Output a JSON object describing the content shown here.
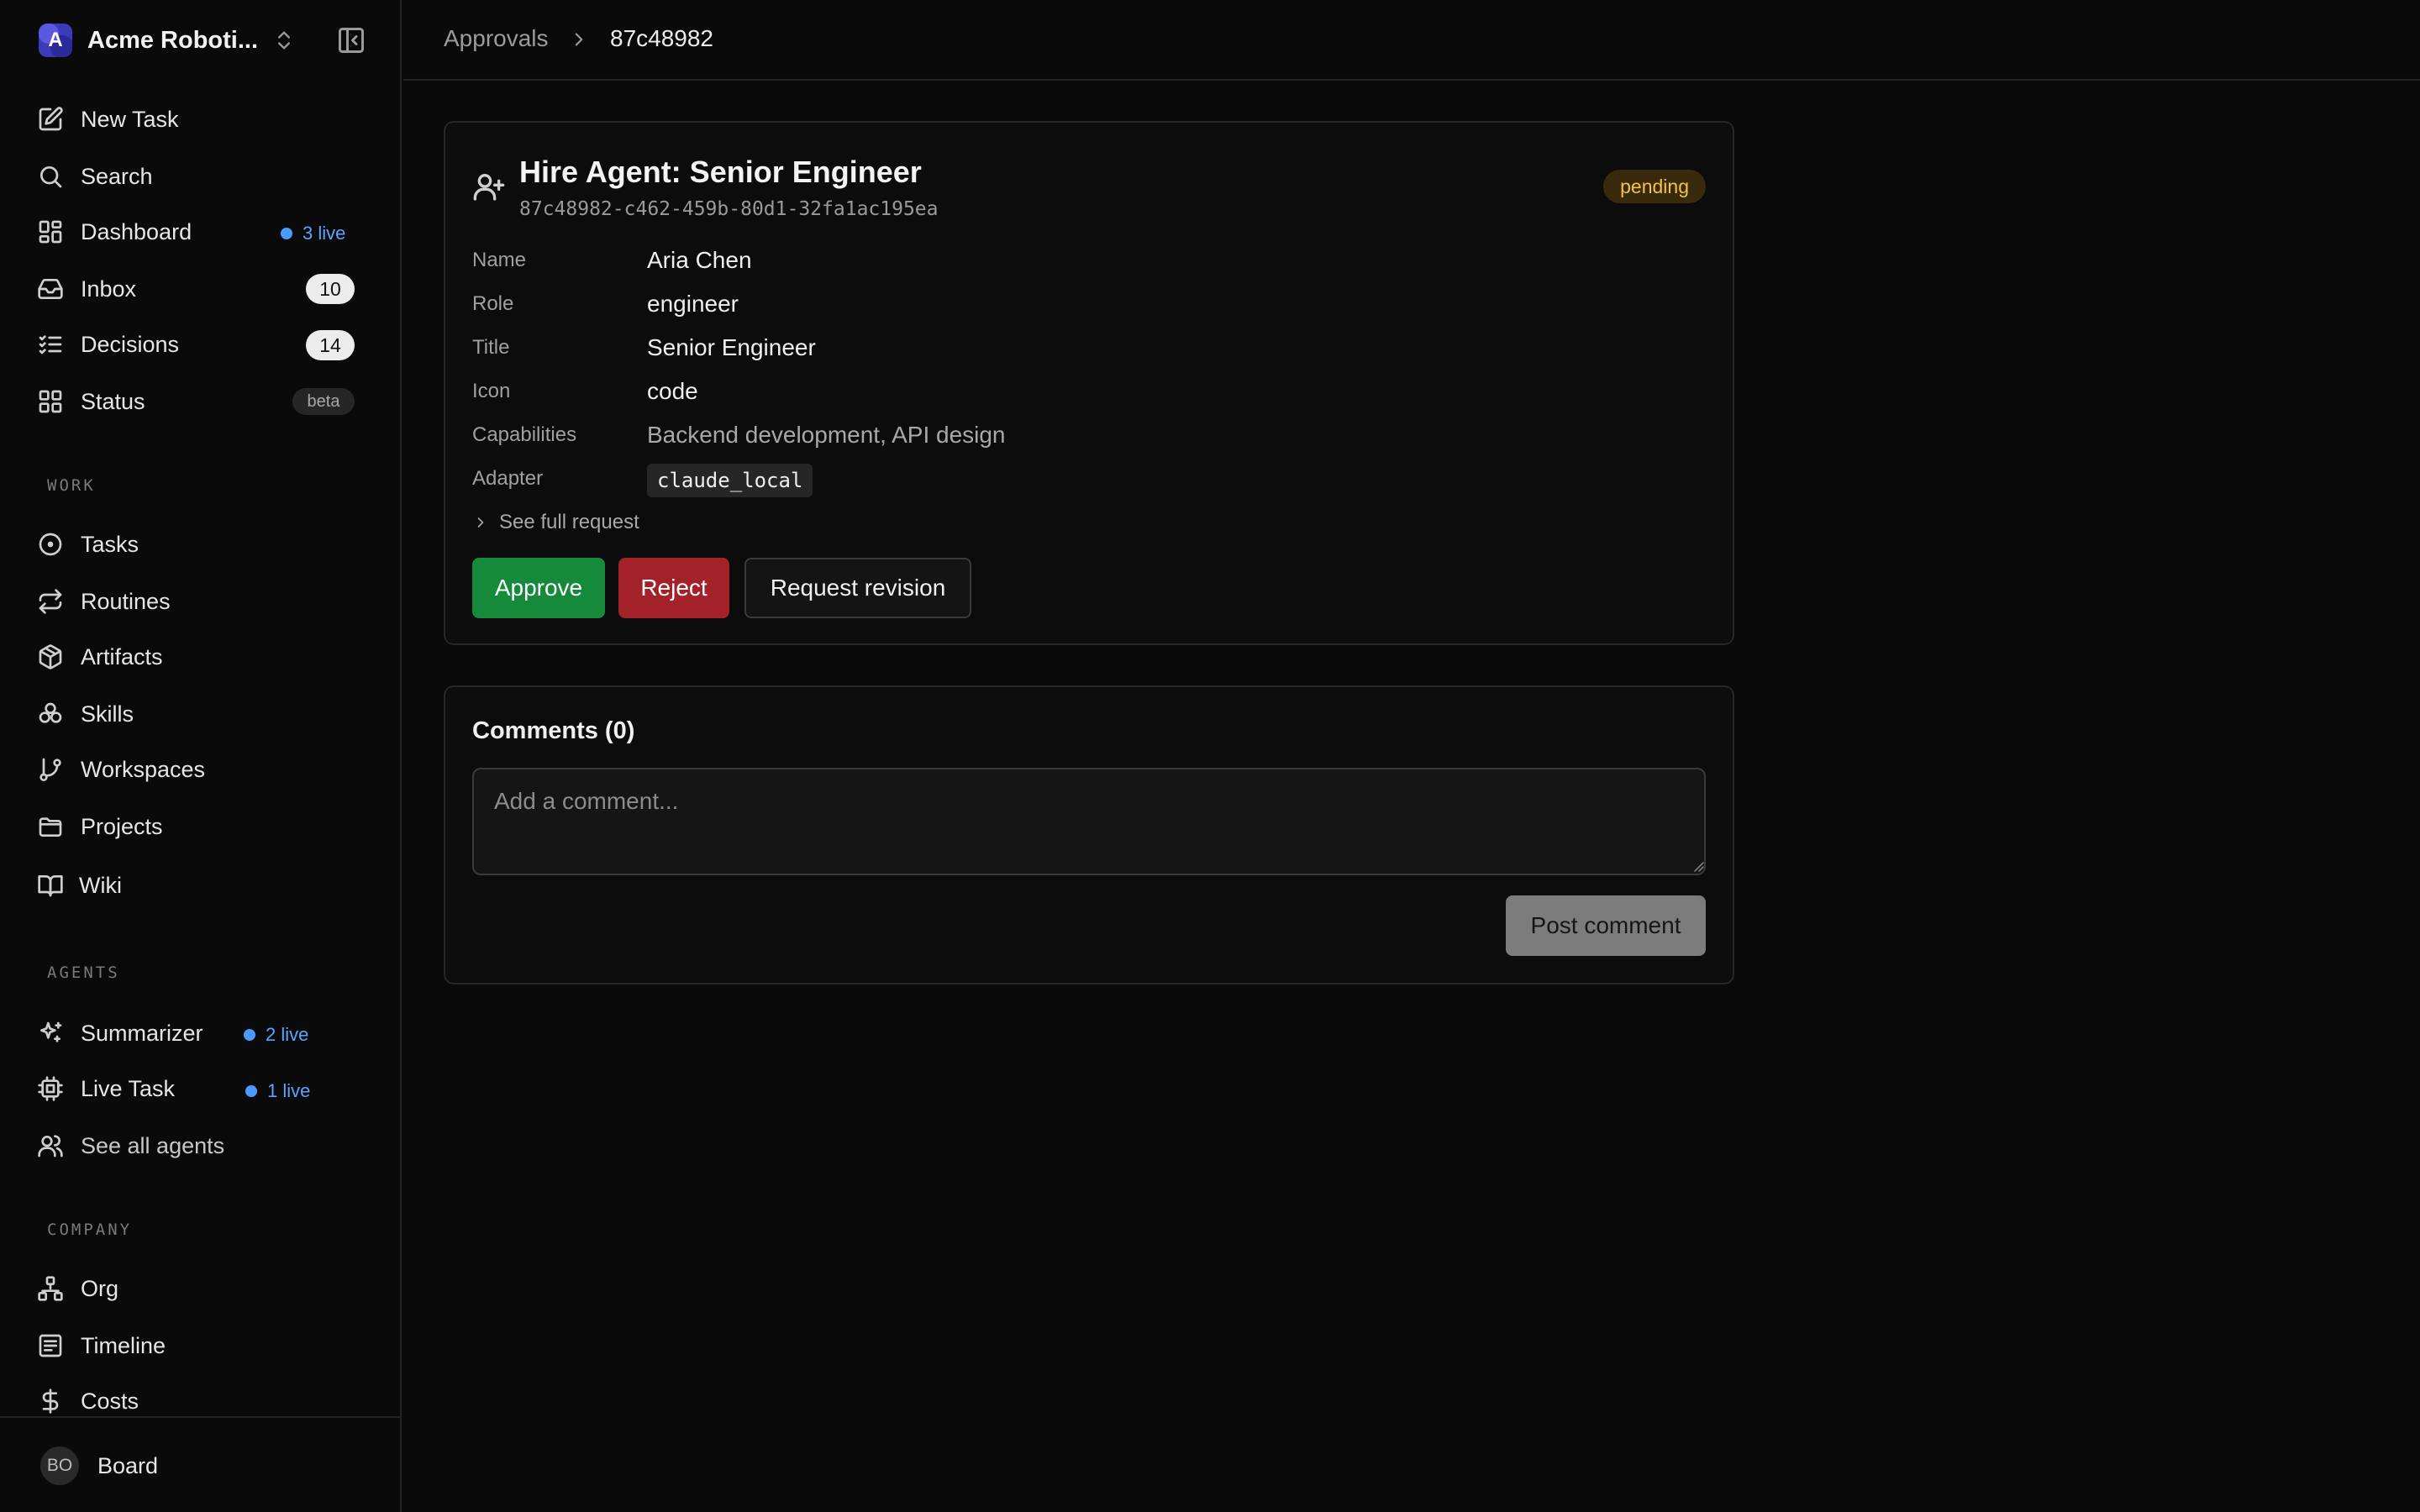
{
  "sidebar": {
    "company_name": "Acme Roboti...",
    "company_initial": "A",
    "nav": [
      {
        "label": "New Task",
        "icon": "edit-icon"
      },
      {
        "label": "Search",
        "icon": "search-icon"
      },
      {
        "label": "Dashboard",
        "icon": "dashboard-icon",
        "live": "3 live"
      },
      {
        "label": "Inbox",
        "icon": "inbox-icon",
        "count": "10"
      },
      {
        "label": "Decisions",
        "icon": "list-checks-icon",
        "count": "14"
      },
      {
        "label": "Status",
        "icon": "grid-icon",
        "badge": "beta"
      }
    ],
    "work_label": "WORK",
    "work": [
      {
        "label": "Tasks",
        "icon": "circle-dot-icon"
      },
      {
        "label": "Routines",
        "icon": "repeat-icon"
      },
      {
        "label": "Artifacts",
        "icon": "package-icon"
      },
      {
        "label": "Skills",
        "icon": "boxes-icon"
      },
      {
        "label": "Workspaces",
        "icon": "git-branch-icon"
      },
      {
        "label": "Projects",
        "icon": "folder-icon"
      },
      {
        "label": "Wiki",
        "icon": "book-icon"
      }
    ],
    "agents_label": "AGENTS",
    "agents": [
      {
        "label": "Summarizer",
        "icon": "sparkles-icon",
        "live": "2 live"
      },
      {
        "label": "Live Task",
        "icon": "cpu-icon",
        "live": "1 live"
      },
      {
        "label": "See all agents",
        "icon": "users-icon"
      }
    ],
    "company_label": "COMPANY",
    "company": [
      {
        "label": "Org",
        "icon": "org-chart-icon"
      },
      {
        "label": "Timeline",
        "icon": "timeline-icon"
      },
      {
        "label": "Costs",
        "icon": "dollar-icon"
      }
    ],
    "user": {
      "initials": "BO",
      "name": "Board"
    }
  },
  "breadcrumb": {
    "parent": "Approvals",
    "current": "87c48982"
  },
  "approval": {
    "title": "Hire Agent: Senior Engineer",
    "id": "87c48982-c462-459b-80d1-32fa1ac195ea",
    "status": "pending",
    "fields": [
      {
        "label": "Name",
        "value": "Aria Chen"
      },
      {
        "label": "Role",
        "value": "engineer"
      },
      {
        "label": "Title",
        "value": "Senior Engineer"
      },
      {
        "label": "Icon",
        "value": "code"
      },
      {
        "label": "Capabilities",
        "value": "Backend development, API design"
      },
      {
        "label": "Adapter",
        "value": "claude_local"
      }
    ],
    "see_full": "See full request",
    "approve_label": "Approve",
    "reject_label": "Reject",
    "revision_label": "Request revision"
  },
  "comments": {
    "title": "Comments (0)",
    "placeholder": "Add a comment...",
    "post_label": "Post comment"
  },
  "colors": {
    "background": "#0a0a0a",
    "approve": "#158a3a",
    "reject": "#a3222a",
    "pending_text": "#f2c14b",
    "live": "#4a9bff"
  }
}
